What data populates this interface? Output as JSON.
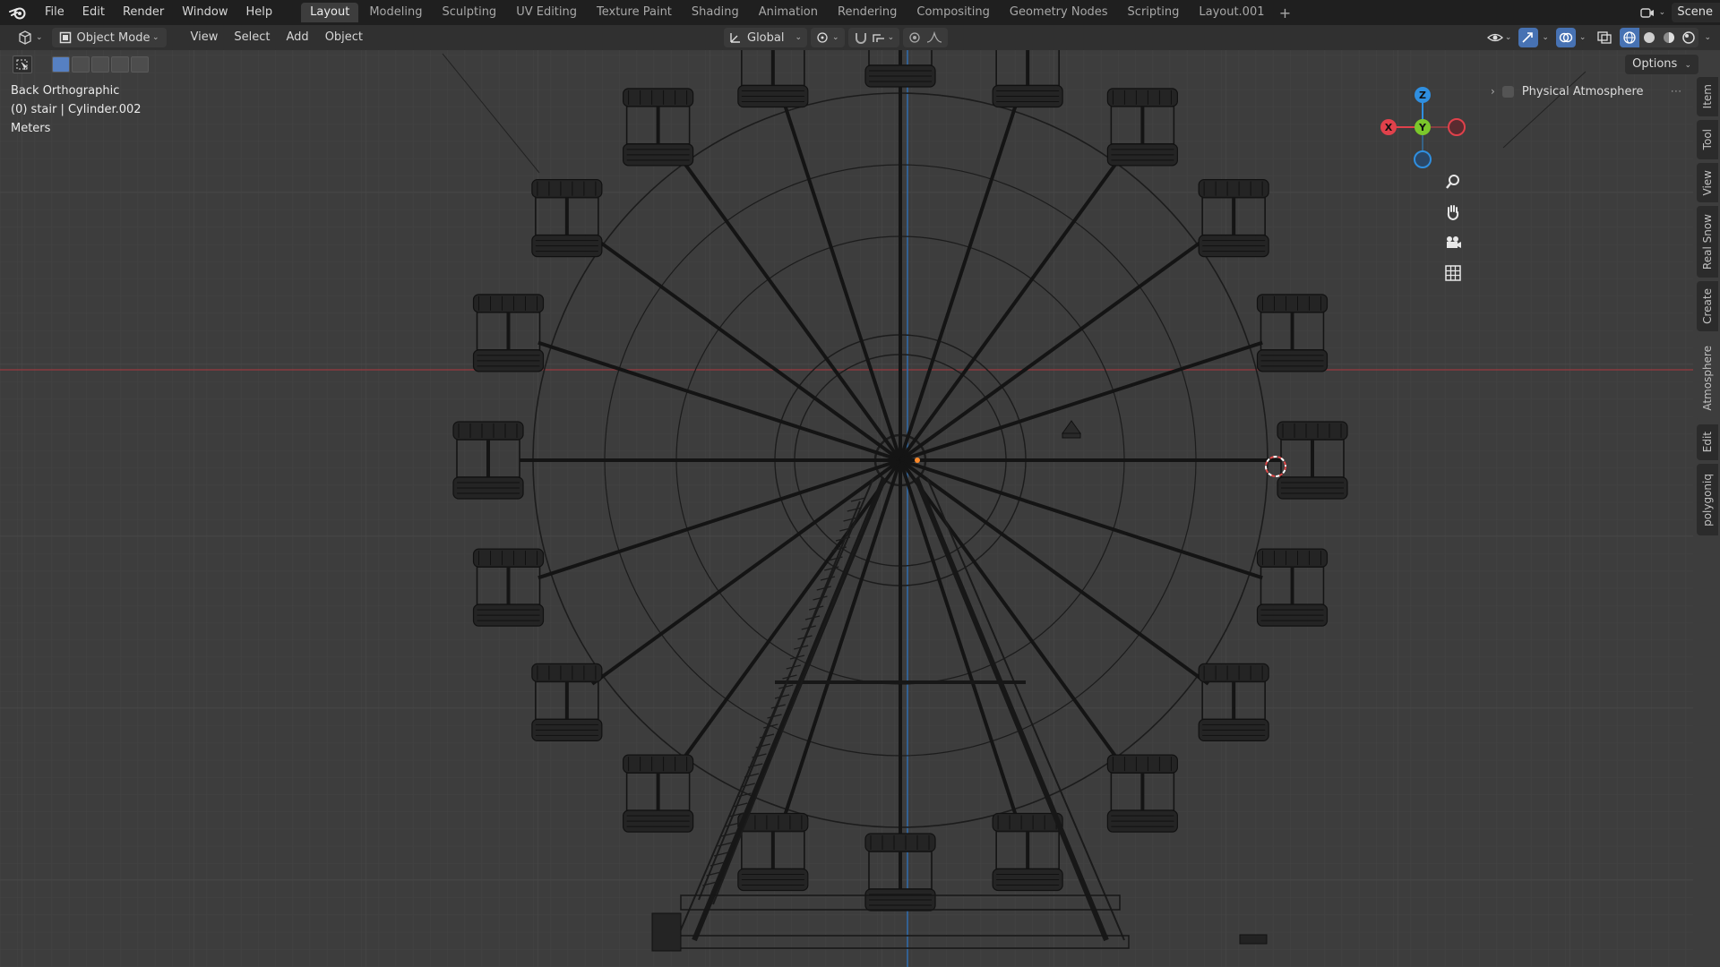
{
  "topbar": {
    "menus": [
      "File",
      "Edit",
      "Render",
      "Window",
      "Help"
    ],
    "workspaces": [
      "Layout",
      "Modeling",
      "Sculpting",
      "UV Editing",
      "Texture Paint",
      "Shading",
      "Animation",
      "Rendering",
      "Compositing",
      "Geometry Nodes",
      "Scripting",
      "Layout.001"
    ],
    "active_workspace": "Layout",
    "add_tab": "+",
    "scene_label": "Scene"
  },
  "header": {
    "mode": "Object Mode",
    "menus": [
      "View",
      "Select",
      "Add",
      "Object"
    ],
    "orientation": "Global",
    "options_label": "Options"
  },
  "viewport": {
    "view_name": "Back Orthographic",
    "collection_object": "(0) stair | Cylinder.002",
    "units": "Meters"
  },
  "gizmo": {
    "z_label": "Z",
    "y_label": "Y",
    "x_label": "X"
  },
  "npanel": {
    "panel_title": "Physical Atmosphere",
    "tabs": [
      "Item",
      "Tool",
      "View",
      "Real Snow",
      "Create",
      "Atmosphere",
      "Edit",
      "polygoniq"
    ]
  },
  "colors": {
    "accent": "#4772b3",
    "x_axis": "#e0414b",
    "y_axis": "#7bc72b",
    "z_axis": "#2f8fe0",
    "grid_bg": "#3d3d3d",
    "wire": "#151515"
  },
  "icons": {
    "blender_logo": "blender-logo-icon",
    "editor_type": "viewport-editor-icon",
    "zoom": "zoom-icon",
    "pan": "hand-icon",
    "camera": "camera-icon",
    "ortho": "grid-icon"
  }
}
